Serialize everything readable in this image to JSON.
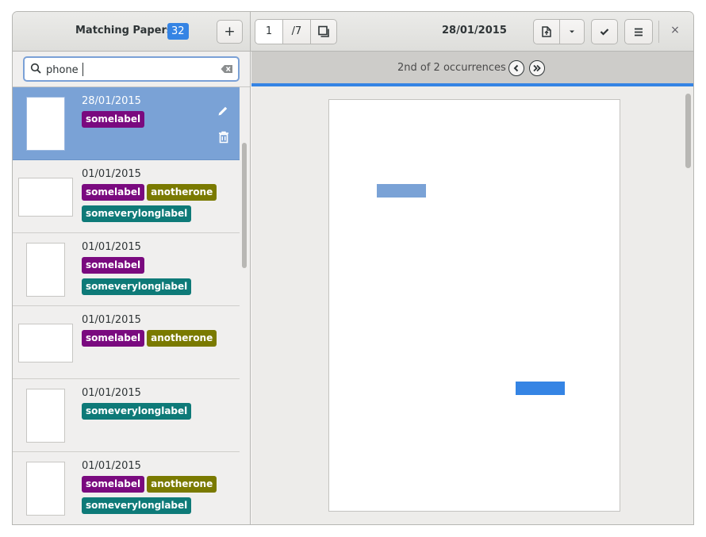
{
  "header": {
    "title": "Matching Papers",
    "count": "32",
    "add_label": "+",
    "page_current": "1",
    "page_total": "/7",
    "doc_date": "28/01/2015",
    "close_label": "×"
  },
  "search": {
    "value": "phone"
  },
  "find": {
    "status": "2nd of 2 occurrences"
  },
  "colors": {
    "accent": "#3584e4",
    "selected_row": "#7aa2d6",
    "label_somelabel": "#7a0a7f",
    "label_anotherone": "#7a7a00",
    "label_someverylonglabel": "#0e7a78",
    "highlight_other": "#7aa2d6",
    "highlight_current": "#3584e4"
  },
  "documents": [
    {
      "date": "28/01/2015",
      "thumb": "portrait",
      "selected": true,
      "labels": [
        {
          "text": "somelabel",
          "color": "#7a0a7f"
        }
      ]
    },
    {
      "date": "01/01/2015",
      "thumb": "landscape",
      "selected": false,
      "labels": [
        {
          "text": "somelabel",
          "color": "#7a0a7f"
        },
        {
          "text": "anotherone",
          "color": "#7a7a00"
        },
        {
          "text": "someverylonglabel",
          "color": "#0e7a78"
        }
      ]
    },
    {
      "date": "01/01/2015",
      "thumb": "portrait",
      "selected": false,
      "labels": [
        {
          "text": "somelabel",
          "color": "#7a0a7f"
        },
        {
          "text": "someverylonglabel",
          "color": "#0e7a78"
        }
      ]
    },
    {
      "date": "01/01/2015",
      "thumb": "landscape",
      "selected": false,
      "labels": [
        {
          "text": "somelabel",
          "color": "#7a0a7f"
        },
        {
          "text": "anotherone",
          "color": "#7a7a00"
        }
      ]
    },
    {
      "date": "01/01/2015",
      "thumb": "portrait",
      "selected": false,
      "labels": [
        {
          "text": "someverylonglabel",
          "color": "#0e7a78"
        }
      ]
    },
    {
      "date": "01/01/2015",
      "thumb": "portrait",
      "selected": false,
      "labels": [
        {
          "text": "somelabel",
          "color": "#7a0a7f"
        },
        {
          "text": "anotherone",
          "color": "#7a7a00"
        },
        {
          "text": "someverylonglabel",
          "color": "#0e7a78"
        }
      ]
    }
  ]
}
